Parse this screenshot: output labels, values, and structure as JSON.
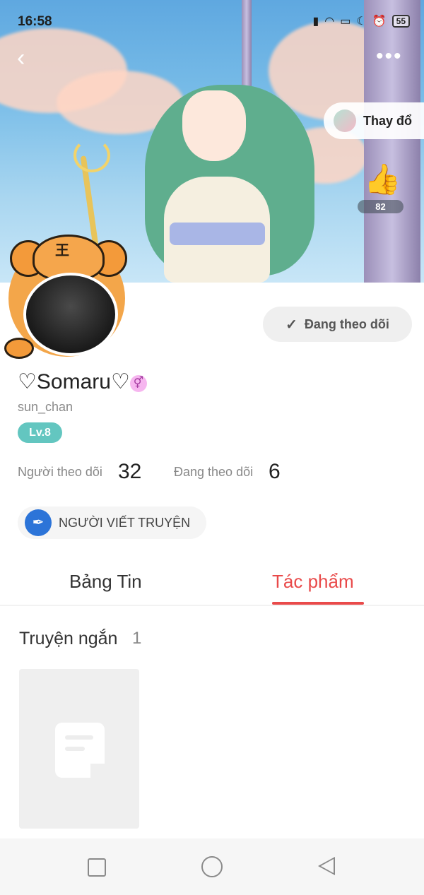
{
  "status_bar": {
    "time": "16:58",
    "battery": "55",
    "icons": [
      "signal-icon",
      "wifi-icon",
      "cast-icon",
      "moon-icon",
      "alarm-icon",
      "battery-icon"
    ]
  },
  "header": {
    "change_label": "Thay đổ",
    "likes": "82"
  },
  "profile": {
    "username": "♡Somaru♡",
    "gender_symbol": "⚥",
    "handle": "sun_chan",
    "level": "Lv.8",
    "follow_button": "Đang theo dõi",
    "followers_label": "Người theo dõi",
    "followers": "32",
    "following_label": "Đang theo dõi",
    "following": "6",
    "writer_badge": "NGƯỜI VIẾT TRUYỆN",
    "avatar_frame_mark": "王"
  },
  "tabs": {
    "feed": "Bảng Tin",
    "works": "Tác phẩm",
    "active": "works"
  },
  "section": {
    "title": "Truyện ngắn",
    "count": "1"
  },
  "colors": {
    "accent": "#e94a4a",
    "level": "#63c6c0",
    "writer_badge": "#2c74d8"
  }
}
